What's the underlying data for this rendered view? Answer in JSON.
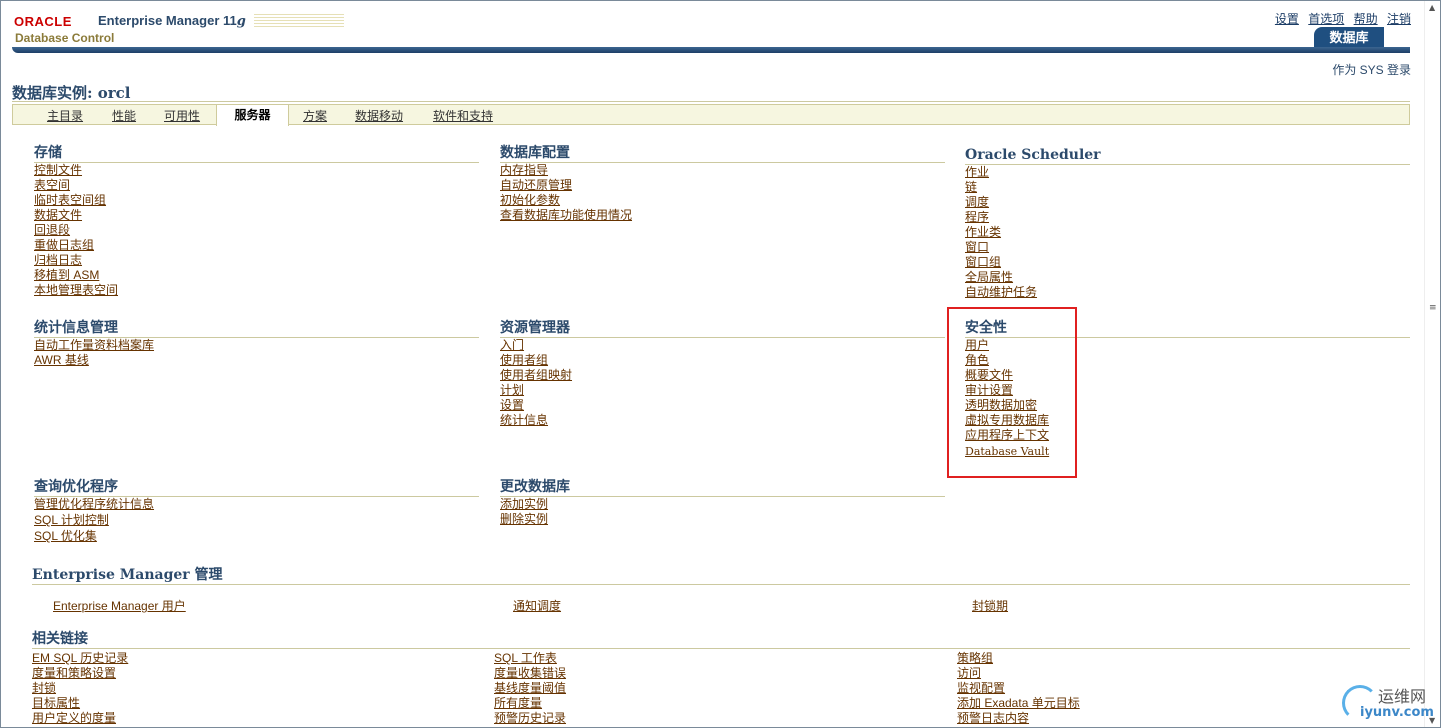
{
  "header": {
    "oracle_logo": "ORACLE",
    "product": "Enterprise Manager 11",
    "product_version_letter": "g",
    "subproduct": "Database Control",
    "global_links": [
      "设置",
      "首选项",
      "帮助",
      "注销"
    ],
    "db_tab": "数据库",
    "login_as": "作为 SYS 登录"
  },
  "page": {
    "title": "数据库实例: orcl"
  },
  "subtabs": [
    {
      "label": "主目录",
      "active": false
    },
    {
      "label": "性能",
      "active": false
    },
    {
      "label": "可用性",
      "active": false
    },
    {
      "label": "服务器",
      "active": true
    },
    {
      "label": "方案",
      "active": false
    },
    {
      "label": "数据移动",
      "active": false
    },
    {
      "label": "软件和支持",
      "active": false
    }
  ],
  "sections": {
    "storage": {
      "title": "存储",
      "items": [
        "控制文件",
        "表空间",
        "临时表空间组",
        "数据文件",
        "回退段",
        "重做日志组",
        "归档日志",
        "移植到 ASM",
        "本地管理表空间"
      ]
    },
    "db_config": {
      "title": "数据库配置",
      "items": [
        "内存指导",
        "自动还原管理",
        "初始化参数",
        "查看数据库功能使用情况"
      ]
    },
    "scheduler": {
      "title": "Oracle Scheduler",
      "items": [
        "作业",
        "链",
        "调度",
        "程序",
        "作业类",
        "窗口",
        "窗口组",
        "全局属性",
        "自动维护任务"
      ]
    },
    "stats": {
      "title": "统计信息管理",
      "items": [
        "自动工作量资料档案库",
        "AWR 基线"
      ]
    },
    "resource": {
      "title": "资源管理器",
      "items": [
        "入门",
        "使用者组",
        "使用者组映射",
        "计划",
        "设置",
        "统计信息"
      ]
    },
    "security": {
      "title": "安全性",
      "items": [
        "用户",
        "角色",
        "概要文件",
        "审计设置",
        "透明数据加密",
        "虚拟专用数据库",
        "应用程序上下文",
        "Database Vault"
      ]
    },
    "query_opt": {
      "title": "查询优化程序",
      "items": [
        "管理优化程序统计信息",
        "SQL 计划控制",
        "SQL 优化集"
      ]
    },
    "change_db": {
      "title": "更改数据库",
      "items": [
        "添加实例",
        "删除实例"
      ]
    },
    "em_admin": {
      "title": "Enterprise Manager 管理",
      "items": [
        "Enterprise Manager 用户",
        "通知调度",
        "封锁期"
      ]
    },
    "related": {
      "title": "相关链接",
      "col1": [
        "EM SQL 历史记录",
        "度量和策略设置",
        "封锁",
        "目标属性",
        "用户定义的度量"
      ],
      "col2": [
        "SQL 工作表",
        "度量收集错误",
        "基线度量阈值",
        "所有度量",
        "预警历史记录"
      ],
      "col3": [
        "策略组",
        "访问",
        "监视配置",
        "添加 Exadata 单元目标",
        "预警日志内容"
      ]
    }
  },
  "watermark": {
    "cn": "运维网",
    "url": "iyunv.com"
  },
  "colors": {
    "accent_blue": "#1f4f80",
    "link": "#663300",
    "highlight_box": "#e02020",
    "oracle_red": "#cc0000"
  }
}
